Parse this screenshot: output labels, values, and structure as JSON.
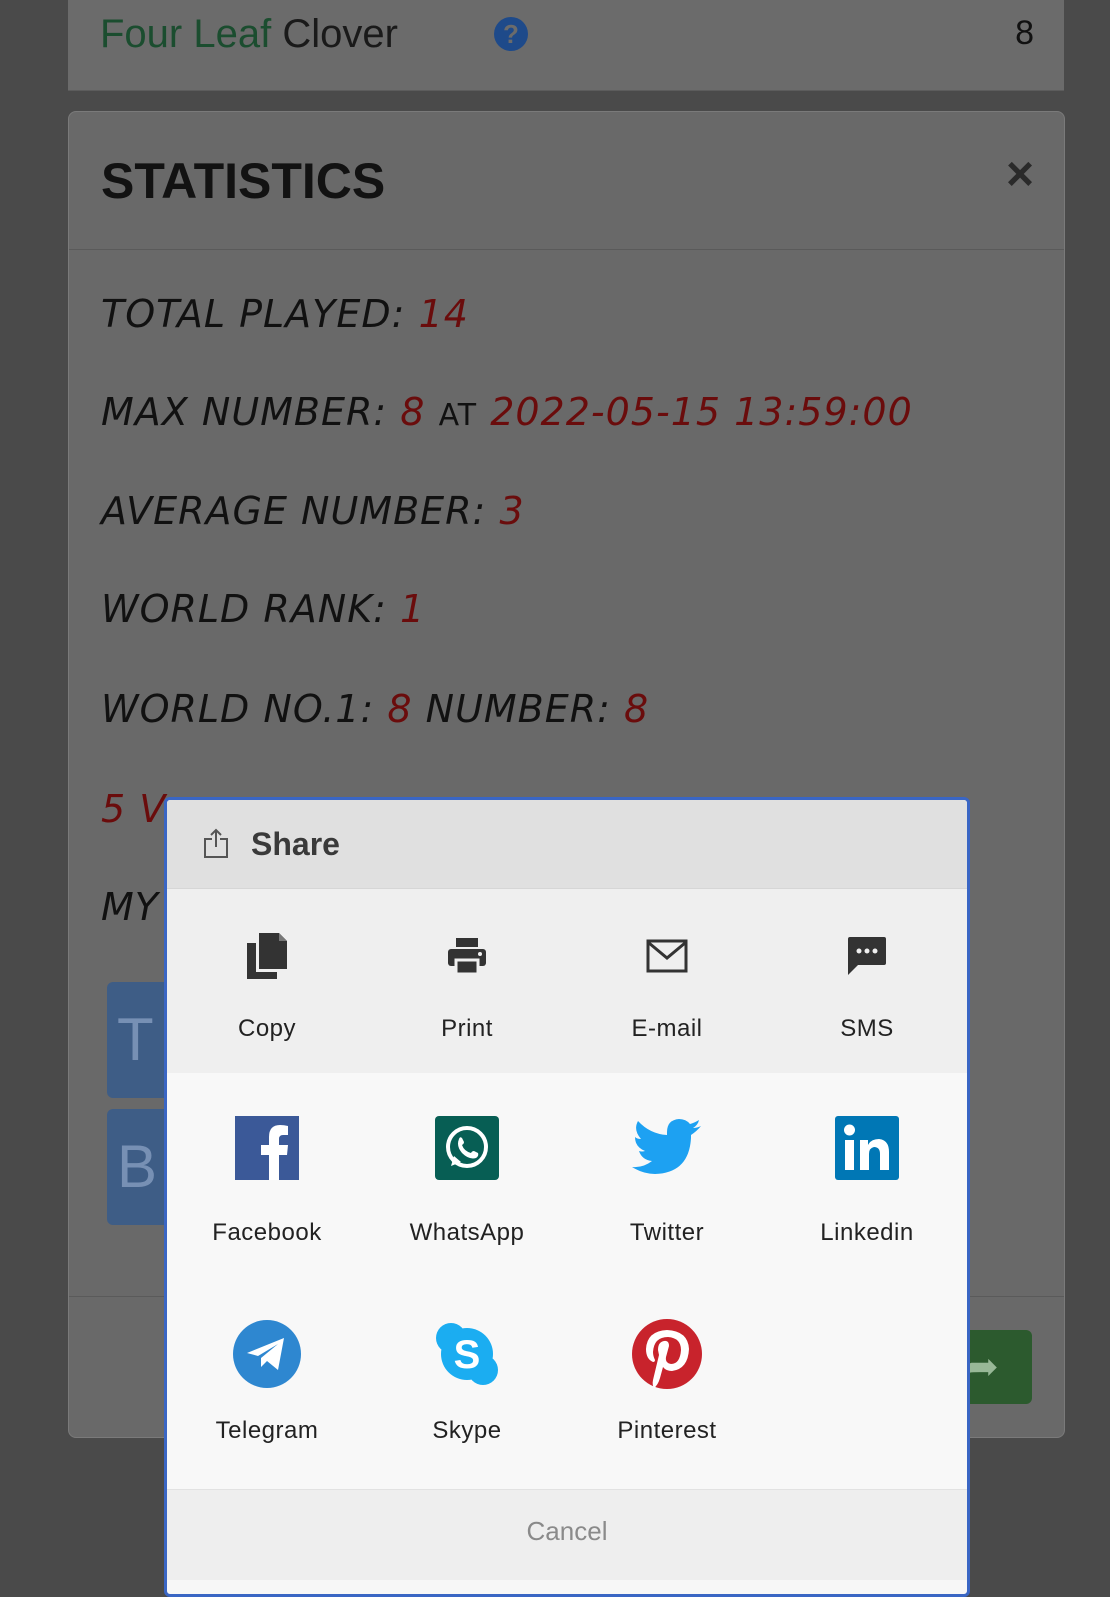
{
  "app": {
    "title_part1": "Four Leaf",
    "title_part2": "Clover",
    "help_glyph": "?",
    "count": "8"
  },
  "stats": {
    "title": "STATISTICS",
    "close_glyph": "×",
    "total_played_label": "TOTAL PLAYED:",
    "total_played_value": "14",
    "max_number_label": "MAX NUMBER:",
    "max_number_value": "8",
    "max_number_at": "AT",
    "max_number_time": "2022-05-15 13:59:00",
    "average_label": "AVERAGE NUMBER:",
    "average_value": "3",
    "world_rank_label": "WORLD RANK:",
    "world_rank_value": "1",
    "world_no1_label": "WORLD NO.1:",
    "world_no1_value": "8",
    "number_label": "NUMBER:",
    "number_value": "8",
    "partial_line_1": "5 V",
    "partial_line_2": "MY",
    "button_1_partial": "T",
    "button_2_partial": "B"
  },
  "share": {
    "title": "Share",
    "system_actions": [
      {
        "label": "Copy",
        "icon": "copy-icon"
      },
      {
        "label": "Print",
        "icon": "print-icon"
      },
      {
        "label": "E-mail",
        "icon": "email-icon"
      },
      {
        "label": "SMS",
        "icon": "sms-icon"
      }
    ],
    "social_row_1": [
      {
        "label": "Facebook",
        "icon": "facebook-icon",
        "color": "#3b5998"
      },
      {
        "label": "WhatsApp",
        "icon": "whatsapp-icon",
        "color": "#075e54"
      },
      {
        "label": "Twitter",
        "icon": "twitter-icon",
        "color": "#1da1f2"
      },
      {
        "label": "Linkedin",
        "icon": "linkedin-icon",
        "color": "#0077b5"
      }
    ],
    "social_row_2": [
      {
        "label": "Telegram",
        "icon": "telegram-icon",
        "color": "#2e87d0"
      },
      {
        "label": "Skype",
        "icon": "skype-icon",
        "color": "#1badf1"
      },
      {
        "label": "Pinterest",
        "icon": "pinterest-icon",
        "color": "#c8232c"
      }
    ],
    "cancel_label": "Cancel"
  }
}
